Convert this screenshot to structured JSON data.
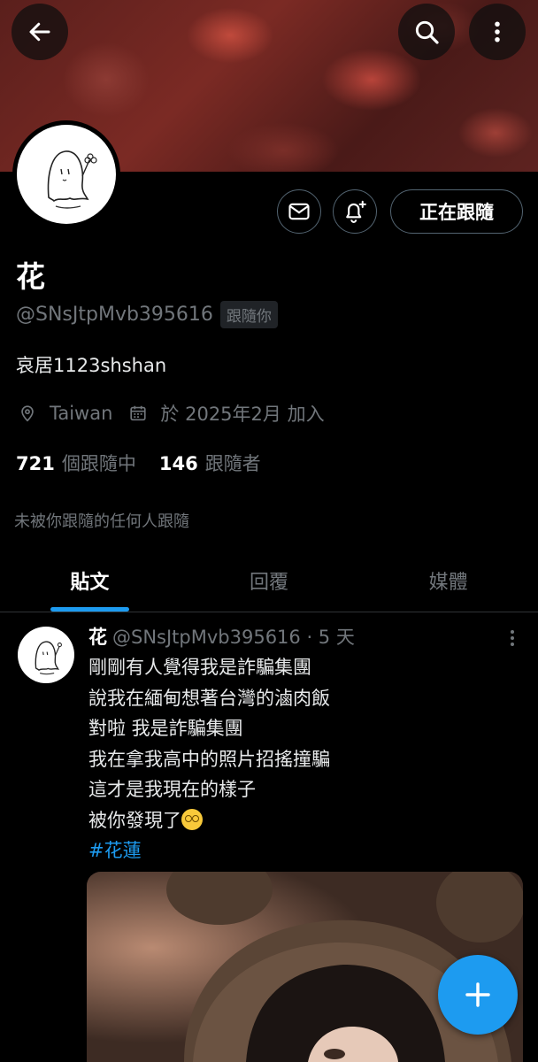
{
  "profile": {
    "display_name": "花",
    "handle": "@SNsJtpMvb395616",
    "follows_you_badge": "跟隨你",
    "bio": "哀居1123shshan",
    "location": "Taiwan",
    "joined": "於 2025年2月 加入",
    "following_count": "721",
    "following_label": "個跟隨中",
    "followers_count": "146",
    "followers_label": "跟隨者",
    "not_followed_note": "未被你跟隨的任何人跟隨"
  },
  "actions": {
    "following_button": "正在跟隨"
  },
  "tabs": [
    {
      "label": "貼文",
      "active": true
    },
    {
      "label": "回覆",
      "active": false
    },
    {
      "label": "媒體",
      "active": false
    }
  ],
  "post": {
    "name": "花",
    "handle_time": "@SNsJtpMvb395616 · 5 天",
    "lines": [
      "剛剛有人覺得我是詐騙集團",
      "說我在緬甸想著台灣的滷肉飯",
      "對啦 我是詐騙集團",
      "我在拿我高中的照片招搖撞騙",
      "這才是我現在的樣子",
      "被你發現了"
    ],
    "emoji": "woozy-face",
    "hashtag": "#花蓮"
  },
  "icons": {
    "back": "arrow-left-icon",
    "search": "search-icon",
    "more": "more-vertical-icon",
    "mail": "mail-icon",
    "notify": "bell-plus-icon",
    "location": "location-pin-icon",
    "calendar": "calendar-icon",
    "compose": "plus-icon"
  },
  "colors": {
    "accent": "#1d9bf0",
    "muted": "#71767b",
    "border": "#536471"
  }
}
